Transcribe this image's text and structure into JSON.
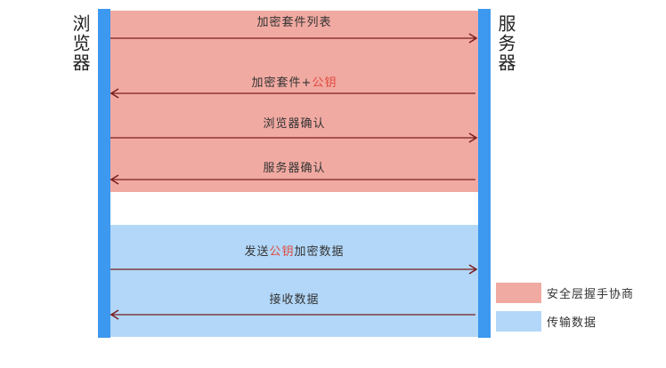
{
  "actors": {
    "left": "浏览器",
    "right": "服务器"
  },
  "colors": {
    "handshake": "#f1aaa2",
    "data": "#b2d7f8",
    "lifeline": "#3d98ef",
    "arrow": "#7a1d1d",
    "highlight": "#e04a3f"
  },
  "messages": [
    {
      "parts": [
        {
          "text": "加密套件列表"
        }
      ],
      "direction": "right"
    },
    {
      "parts": [
        {
          "text": "加密套件+"
        },
        {
          "text": "公钥",
          "highlight": true
        }
      ],
      "direction": "left"
    },
    {
      "parts": [
        {
          "text": "浏览器确认"
        }
      ],
      "direction": "right"
    },
    {
      "parts": [
        {
          "text": "服务器确认"
        }
      ],
      "direction": "left"
    },
    {
      "parts": [
        {
          "text": "发送"
        },
        {
          "text": "公钥",
          "highlight": true
        },
        {
          "text": "加密数据"
        }
      ],
      "direction": "right"
    },
    {
      "parts": [
        {
          "text": "接收数据"
        }
      ],
      "direction": "left"
    }
  ],
  "legend": [
    {
      "label": "安全层握手协商",
      "color": "#f1aaa2"
    },
    {
      "label": "传输数据",
      "color": "#b2d7f8"
    }
  ]
}
